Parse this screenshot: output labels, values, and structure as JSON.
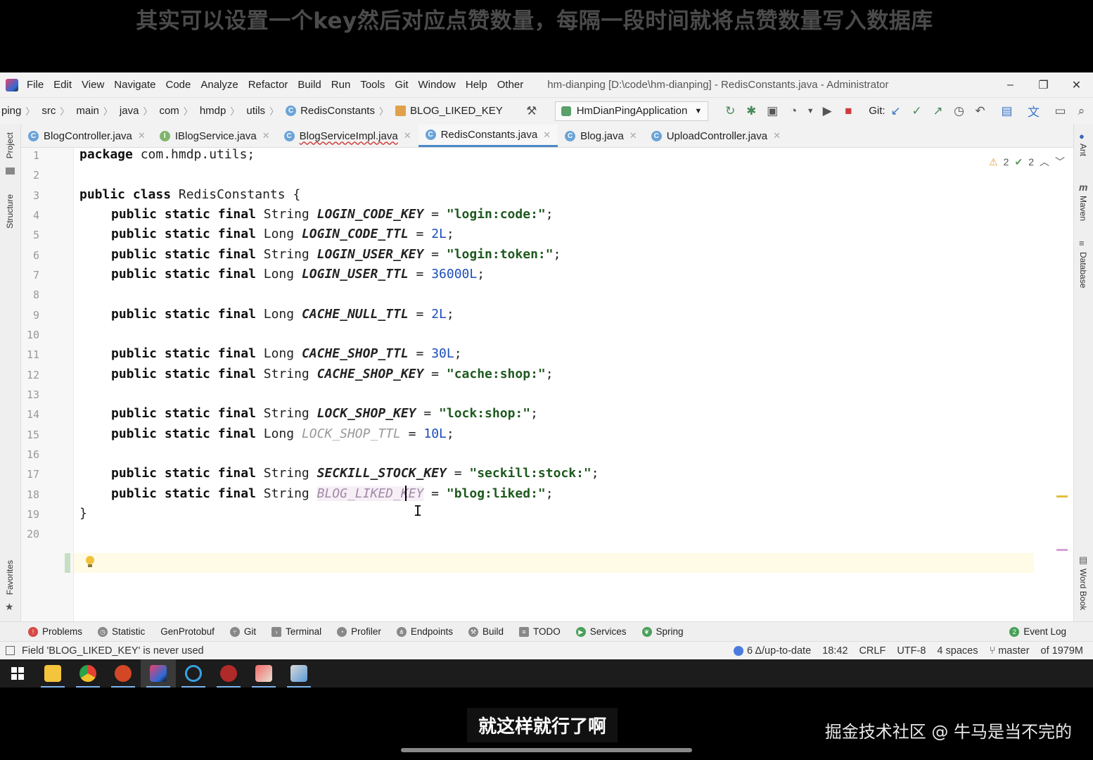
{
  "top_caption": "其实可以设置一个key然后对应点赞数量，每隔一段时间就将点赞数量写入数据库",
  "menu": {
    "items": [
      "File",
      "Edit",
      "View",
      "Navigate",
      "Code",
      "Analyze",
      "Refactor",
      "Build",
      "Run",
      "Tools",
      "Git",
      "Window",
      "Help",
      "Other"
    ],
    "title": "hm-dianping [D:\\code\\hm-dianping] - RedisConstants.java - Administrator"
  },
  "breadcrumb": {
    "items": [
      "ping",
      "src",
      "main",
      "java",
      "com",
      "hmdp",
      "utils"
    ],
    "class_name": "RedisConstants",
    "field_name": "BLOG_LIKED_KEY"
  },
  "run_config": "HmDianPingApplication",
  "git_label": "Git:",
  "tabs": [
    {
      "label": "BlogController.java",
      "icon": "C"
    },
    {
      "label": "IBlogService.java",
      "icon": "I"
    },
    {
      "label": "BlogServiceImpl.java",
      "icon": "C"
    },
    {
      "label": "RedisConstants.java",
      "icon": "C"
    },
    {
      "label": "Blog.java",
      "icon": "C"
    },
    {
      "label": "UploadController.java",
      "icon": "C"
    }
  ],
  "side_labels": {
    "project": "Project",
    "structure": "Structure",
    "favorites": "Favorites",
    "ant": "Ant",
    "maven": "Maven",
    "database": "Database",
    "word_book": "Word Book"
  },
  "inspections": {
    "warnings": "2",
    "checks": "2"
  },
  "code": {
    "line_numbers": [
      "1",
      "2",
      "3",
      "4",
      "5",
      "6",
      "7",
      "8",
      "9",
      "10",
      "11",
      "12",
      "13",
      "14",
      "15",
      "16",
      "17",
      "18",
      "19",
      "20"
    ],
    "package_kw": "package",
    "package_name": " com.hmdp.utils;",
    "class_decl_kw": "public class",
    "class_decl_name": " RedisConstants {",
    "modifiers": "public static final",
    "closing": "}",
    "fields": [
      {
        "type": "String",
        "name": "LOGIN_CODE_KEY",
        "value": "\"login:code:\""
      },
      {
        "type": "Long",
        "name": "LOGIN_CODE_TTL",
        "value": "2L"
      },
      {
        "type": "String",
        "name": "LOGIN_USER_KEY",
        "value": "\"login:token:\""
      },
      {
        "type": "Long",
        "name": "LOGIN_USER_TTL",
        "value": "36000L"
      },
      {
        "type": "Long",
        "name": "CACHE_NULL_TTL",
        "value": "2L"
      },
      {
        "type": "Long",
        "name": "CACHE_SHOP_TTL",
        "value": "30L"
      },
      {
        "type": "String",
        "name": "CACHE_SHOP_KEY",
        "value": "\"cache:shop:\""
      },
      {
        "type": "String",
        "name": "LOCK_SHOP_KEY",
        "value": "\"lock:shop:\""
      },
      {
        "type": "Long",
        "name": "LOCK_SHOP_TTL",
        "value": "10L"
      },
      {
        "type": "String",
        "name": "SECKILL_STOCK_KEY",
        "value": "\"seckill:stock:\""
      },
      {
        "type": "String",
        "name": "BLOG_LIKED_KEY",
        "value": "\"blog:liked:\""
      }
    ]
  },
  "bottom_tools": [
    "Problems",
    "Statistic",
    "GenProtobuf",
    "Git",
    "Terminal",
    "Profiler",
    "Endpoints",
    "Build",
    "TODO",
    "Services",
    "Spring",
    "Event Log"
  ],
  "status": {
    "message": "Field 'BLOG_LIKED_KEY' is never used",
    "vcs": "6 Δ/up-to-date",
    "position": "18:42",
    "line_sep": "CRLF",
    "encoding": "UTF-8",
    "indent": "4 spaces",
    "branch": "master",
    "memory": "of 1979M"
  },
  "bottom_caption": "就这样就行了啊",
  "watermark": "掘金技术社区 @ 牛马是当不完的",
  "colors": {
    "accent": "#4a88c7",
    "string": "#1f5a1f",
    "number": "#1a4dbb",
    "unused_field": "#a48aa8",
    "current_line": "#fffbe6"
  }
}
